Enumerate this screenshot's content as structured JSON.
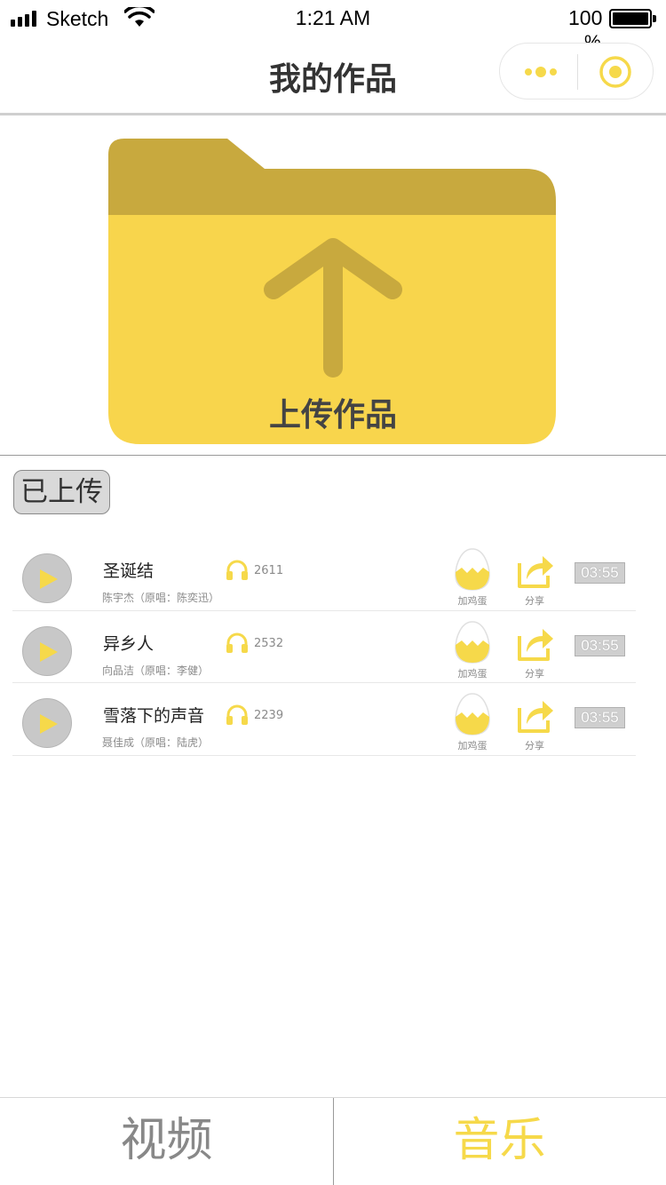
{
  "status_bar": {
    "carrier": "Sketch",
    "time": "1:21 AM",
    "battery_level": "100",
    "battery_unit": "%"
  },
  "nav": {
    "title": "我的作品",
    "more_icon": "more-dots-icon",
    "close_icon": "target-circle-icon"
  },
  "upload": {
    "label": "上传作品",
    "icon": "folder-upload-icon"
  },
  "section": {
    "badge": "已上传"
  },
  "tracks": [
    {
      "title": "圣诞结",
      "subtitle": "陈宇杰（原唱：陈奕迅）",
      "plays": "2611",
      "egg_label": "加鸡蛋",
      "share_label": "分享",
      "duration": "03:55"
    },
    {
      "title": "异乡人",
      "subtitle": "向品洁（原唱：李健）",
      "plays": "2532",
      "egg_label": "加鸡蛋",
      "share_label": "分享",
      "duration": "03:55"
    },
    {
      "title": "雪落下的声音",
      "subtitle": "聂佳成（原唱：陆虎）",
      "plays": "2239",
      "egg_label": "加鸡蛋",
      "share_label": "分享",
      "duration": "03:55"
    }
  ],
  "tabs": [
    {
      "label": "视频",
      "active": false
    },
    {
      "label": "音乐",
      "active": true
    }
  ],
  "colors": {
    "accent": "#f6d94a",
    "folder_front": "#f8d54c",
    "folder_back": "#c8a93e",
    "grey": "#c8c8c8"
  }
}
